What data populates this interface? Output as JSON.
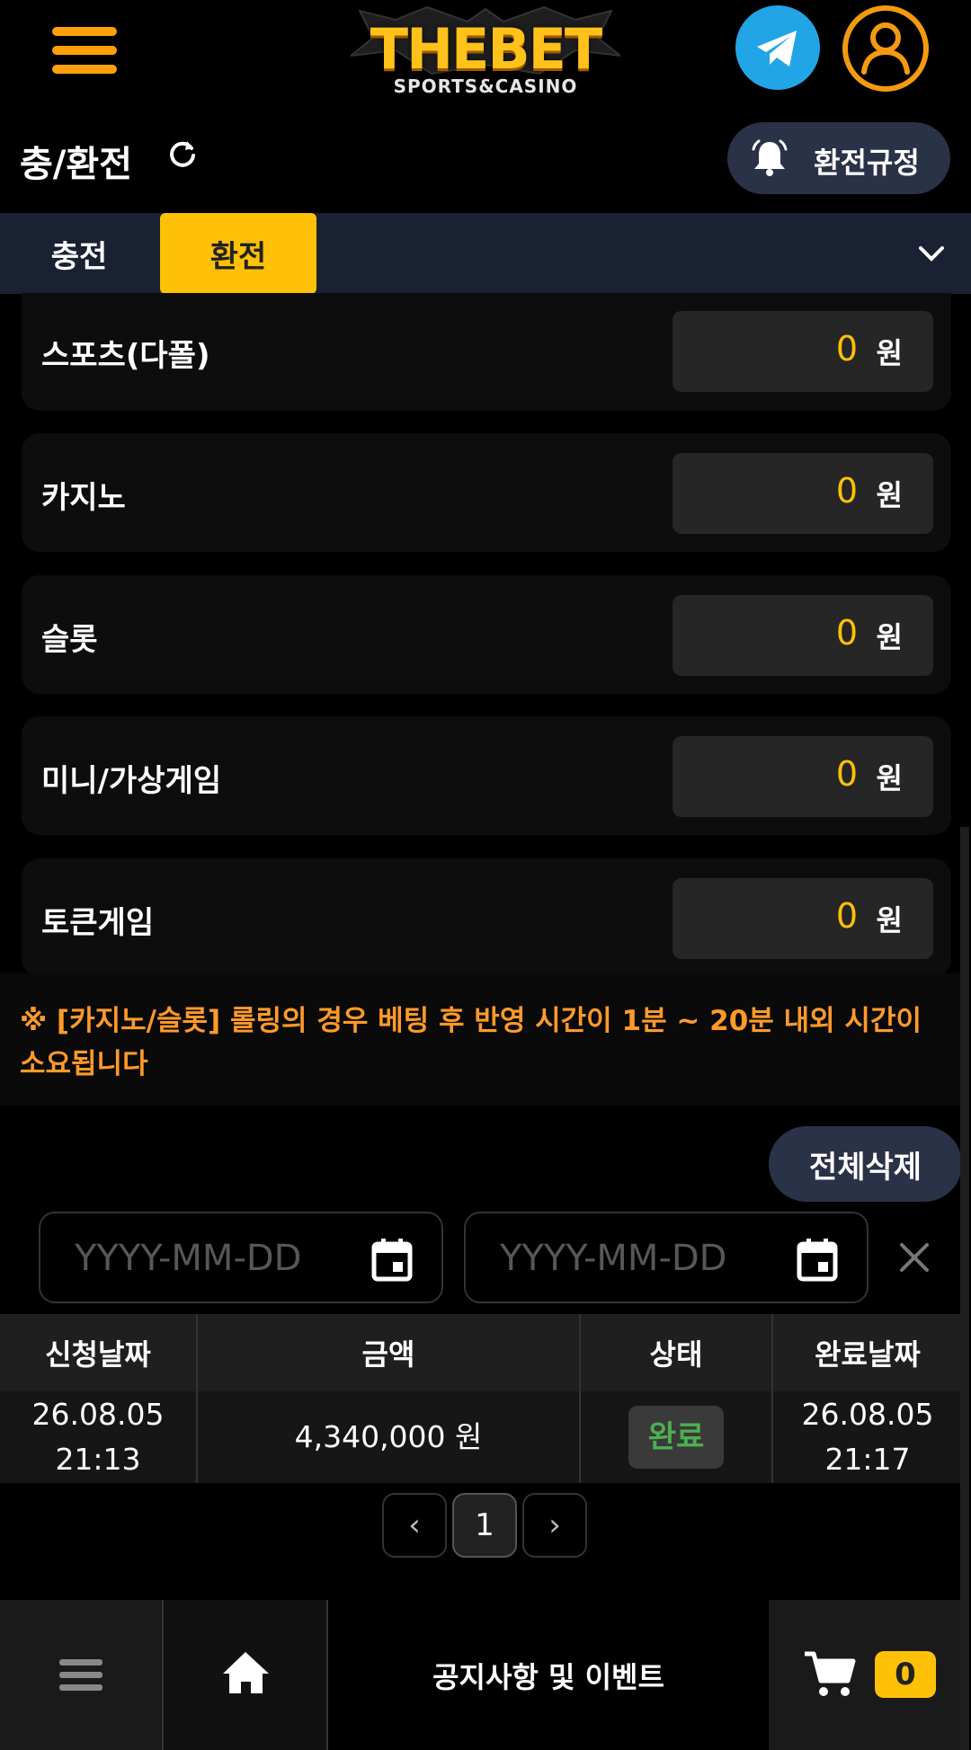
{
  "header": {
    "logo_text": "THEBET",
    "logo_sub": "SPORTS&CASINO",
    "telegram_icon": "telegram-icon",
    "user_icon": "user-icon",
    "accent": "#ff9f0a"
  },
  "title_row": {
    "title": "충/환전",
    "rules_label": "환전규정"
  },
  "tabs": [
    {
      "label": "충전",
      "active": false
    },
    {
      "label": "환전",
      "active": true
    }
  ],
  "items": [
    {
      "name": "스포츠(다폴)",
      "value": "0",
      "unit": "원"
    },
    {
      "name": "카지노",
      "value": "0",
      "unit": "원"
    },
    {
      "name": "슬롯",
      "value": "0",
      "unit": "원"
    },
    {
      "name": "미니/가상게임",
      "value": "0",
      "unit": "원"
    },
    {
      "name": "토큰게임",
      "value": "0",
      "unit": "원"
    }
  ],
  "notice": "※ [카지노/슬롯] 롤링의 경우 베팅 후 반영 시간이 1분 ~ 20분 내외 시간이 소요됩니다",
  "delete_all_label": "전체삭제",
  "date_filter": {
    "start_placeholder": "YYYY-MM-DD",
    "end_placeholder": "YYYY-MM-DD"
  },
  "table": {
    "headers": [
      "신청날짜",
      "금액",
      "상태",
      "완료날짜"
    ],
    "rows": [
      {
        "request_date": "26.08.05",
        "request_time": "21:13",
        "amount": "4,340,000 원",
        "status": "완료",
        "complete_date": "26.08.05",
        "complete_time": "21:17"
      }
    ]
  },
  "pagination": {
    "current": "1",
    "prev": "‹",
    "next": "›"
  },
  "bottom_nav": {
    "notice_label": "공지사항 및 이벤트",
    "cart_count": "0"
  }
}
